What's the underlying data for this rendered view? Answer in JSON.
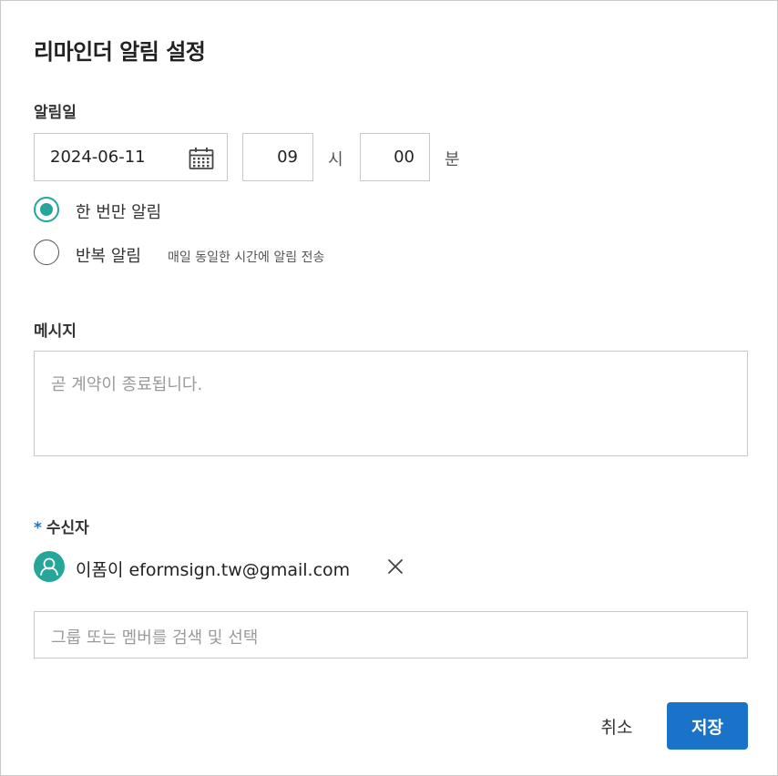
{
  "dialog": {
    "title": "리마인더 알림 설정"
  },
  "alert_date": {
    "label": "알림일",
    "date": "2024-06-11",
    "hour": "09",
    "hour_unit": "시",
    "minute": "00",
    "minute_unit": "분"
  },
  "repeat": {
    "options": [
      {
        "label": "한 번만 알림",
        "checked": true
      },
      {
        "label": "반복 알림",
        "checked": false,
        "hint": "매일 동일한 시간에 알림 전송"
      }
    ]
  },
  "message": {
    "label": "메시지",
    "placeholder": "곧 계약이 종료됩니다."
  },
  "recipients": {
    "required_mark": "*",
    "label": "수신자",
    "items": [
      {
        "name": "이폼이",
        "email": "eformsign.tw@gmail.com",
        "text": "이폼이 eformsign.tw@gmail.com"
      }
    ],
    "search_placeholder": "그룹 또는 멤버를 검색 및 선택"
  },
  "footer": {
    "cancel_label": "취소",
    "save_label": "저장"
  },
  "colors": {
    "accent": "#26a69a",
    "primary": "#1a73c8",
    "border": "#c8c8c8",
    "placeholder": "#9a9a9a"
  },
  "icons": {
    "date_picker": "calendar-icon",
    "recipient_avatar": "user-icon",
    "remove_recipient": "close-icon"
  }
}
